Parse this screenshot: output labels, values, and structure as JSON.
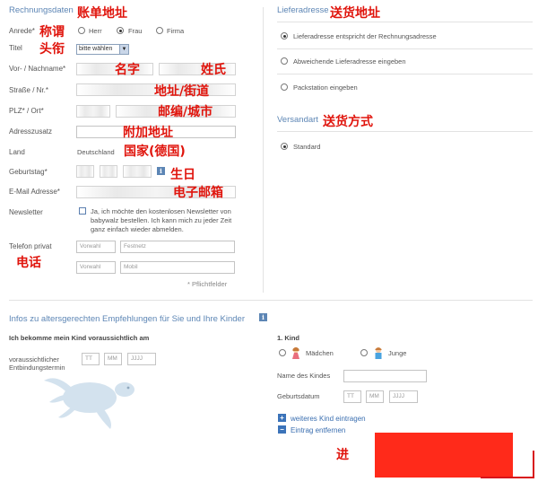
{
  "billing": {
    "title": "Rechnungsdaten",
    "title_cn": "账单地址",
    "salutation_label": "Anrede*",
    "salutation_cn": "称谓",
    "salutation_options": [
      "Herr",
      "Frau",
      "Firma"
    ],
    "salutation_selected": "Frau",
    "title_label": "Titel",
    "title_cn_label": "头衔",
    "title_select": "bitte wählen",
    "name_label": "Vor- / Nachname*",
    "firstname_cn": "名字",
    "lastname_cn": "姓氏",
    "street_label": "Straße / Nr.*",
    "street_cn": "地址/街道",
    "zip_label": "PLZ* / Ort*",
    "zip_cn": "邮编/城市",
    "addition_label": "Adresszusatz",
    "addition_cn": "附加地址",
    "country_label": "Land",
    "country_value": "Deutschland",
    "country_cn": "国家(德国)",
    "birthday_label": "Geburtstag*",
    "birthday_cn": "生日",
    "email_label": "E-Mail Adresse*",
    "email_cn": "电子邮箱",
    "newsletter_label": "Newsletter",
    "newsletter_text": [
      "Ja, ich möchte den kostenlosen Newsletter von",
      "babywalz bestellen. Ich kann mich zu jeder Zeit",
      "ganz einfach wieder abmelden."
    ],
    "phone_label": "Telefon privat",
    "phone_cn": "电话",
    "phone_rows": [
      {
        "prefix": "Vorwahl",
        "number": "Festnetz"
      },
      {
        "prefix": "Vorwahl",
        "number": "Mobil"
      }
    ],
    "required_note": "* Pflichtfelder"
  },
  "delivery": {
    "title": "Lieferadresse",
    "title_cn": "送货地址",
    "options": [
      "Lieferadresse entspricht der Rechnungsadresse",
      "Abweichende Lieferadresse eingeben",
      "Packstation eingeben"
    ],
    "selected": "Lieferadresse entspricht der Rechnungsadresse"
  },
  "shipping": {
    "title": "Versandart",
    "title_cn": "送货方式",
    "options": [
      "Standard"
    ],
    "selected": "Standard"
  },
  "recommendations": {
    "title": "Infos zu altersgerechten Empfehlungen für Sie und Ihre Kinder",
    "expect_text": "Ich bekomme mein Kind voraussichtlich am",
    "due_label_1": "voraussichtlicher",
    "due_label_2": "Entbindungstermin",
    "date_placeholders": [
      "TT",
      "MM",
      "JJJJ"
    ],
    "child_heading": "1.  Kind",
    "gender_options": [
      "Mädchen",
      "Junge"
    ],
    "child_name_label": "Name des Kindes",
    "child_birth_label": "Geburtsdatum",
    "add_child": "weiteres Kind eintragen",
    "remove_entry": "Eintrag entfernen",
    "continue_cn": "进"
  },
  "colors": {
    "accent_blue": "#5d86b5",
    "annotation_red": "#e0140c",
    "button_red": "#ff2a1a"
  }
}
